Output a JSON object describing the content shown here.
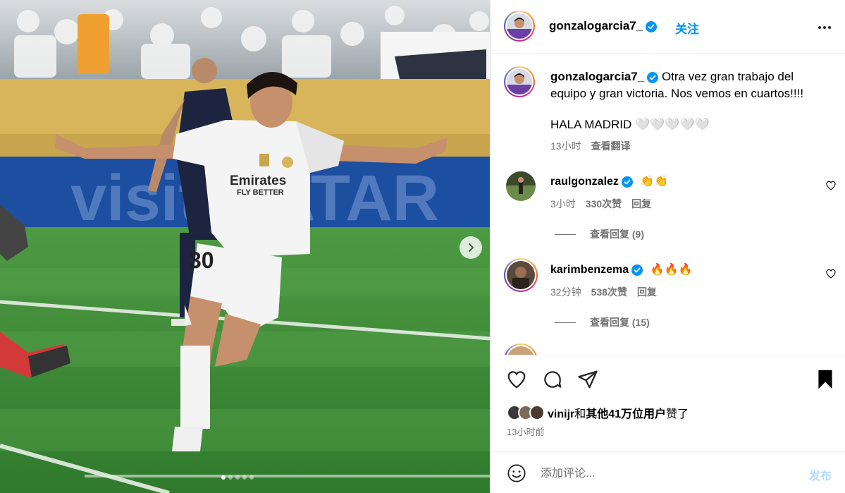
{
  "photo": {
    "shirt_sponsor_line1": "Emirates",
    "shirt_sponsor_line2": "FLY BETTER",
    "shirt_number": "30",
    "board_text": "visit QATAR",
    "carousel_dots": 5,
    "carousel_active": 1
  },
  "header": {
    "username": "gonzalogarcia7_",
    "follow_label": "关注"
  },
  "caption": {
    "username": "gonzalogarcia7_",
    "text": "Otra vez gran trabajo del equipo y gran victoria. Nos vemos en cuartos!!!!",
    "line2": "HALA MADRID 🤍🤍🤍🤍🤍",
    "time": "13小时",
    "translate_label": "查看翻译"
  },
  "comments": [
    {
      "username": "raulgonzalez",
      "text": "👏👏",
      "time": "3小时",
      "likes": "330次赞",
      "reply_label": "回复",
      "view_replies": "查看回复 (9)"
    },
    {
      "username": "karimbenzema",
      "text": "🔥🔥🔥",
      "time": "32分钟",
      "likes": "538次赞",
      "reply_label": "回复",
      "view_replies": "查看回复 (15)"
    }
  ],
  "likes": {
    "liker": "vinijr",
    "connector": "和",
    "others": "其他41万位用户",
    "suffix": "赞了"
  },
  "post_time": "13小时前",
  "comment_box": {
    "placeholder": "添加评论...",
    "post_label": "发布"
  },
  "colors": {
    "accent": "#0095f6",
    "post_disabled": "#b3dbff",
    "muted": "#737373"
  }
}
